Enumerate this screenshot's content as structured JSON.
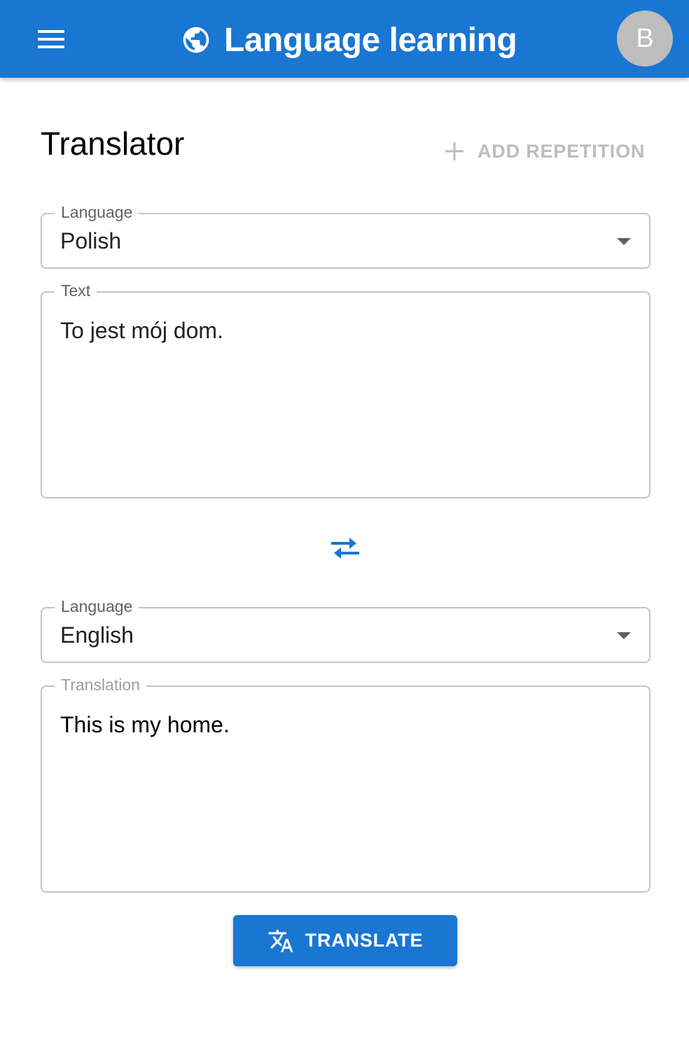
{
  "app": {
    "title": "Language learning",
    "avatar_initial": "B",
    "accent_color": "#1976d2"
  },
  "icons": {
    "menu": "menu-icon",
    "globe": "globe-icon",
    "plus": "plus-icon",
    "swap": "swap-icon",
    "translate": "translate-icon"
  },
  "page": {
    "title": "Translator",
    "add_repetition_label": "ADD REPETITION"
  },
  "source": {
    "language_label": "Language",
    "language_value": "Polish",
    "text_label": "Text",
    "text_value": "To jest mój dom."
  },
  "target": {
    "language_label": "Language",
    "language_value": "English",
    "translation_label": "Translation",
    "translation_value": "This is my home."
  },
  "actions": {
    "translate_label": "TRANSLATE"
  }
}
